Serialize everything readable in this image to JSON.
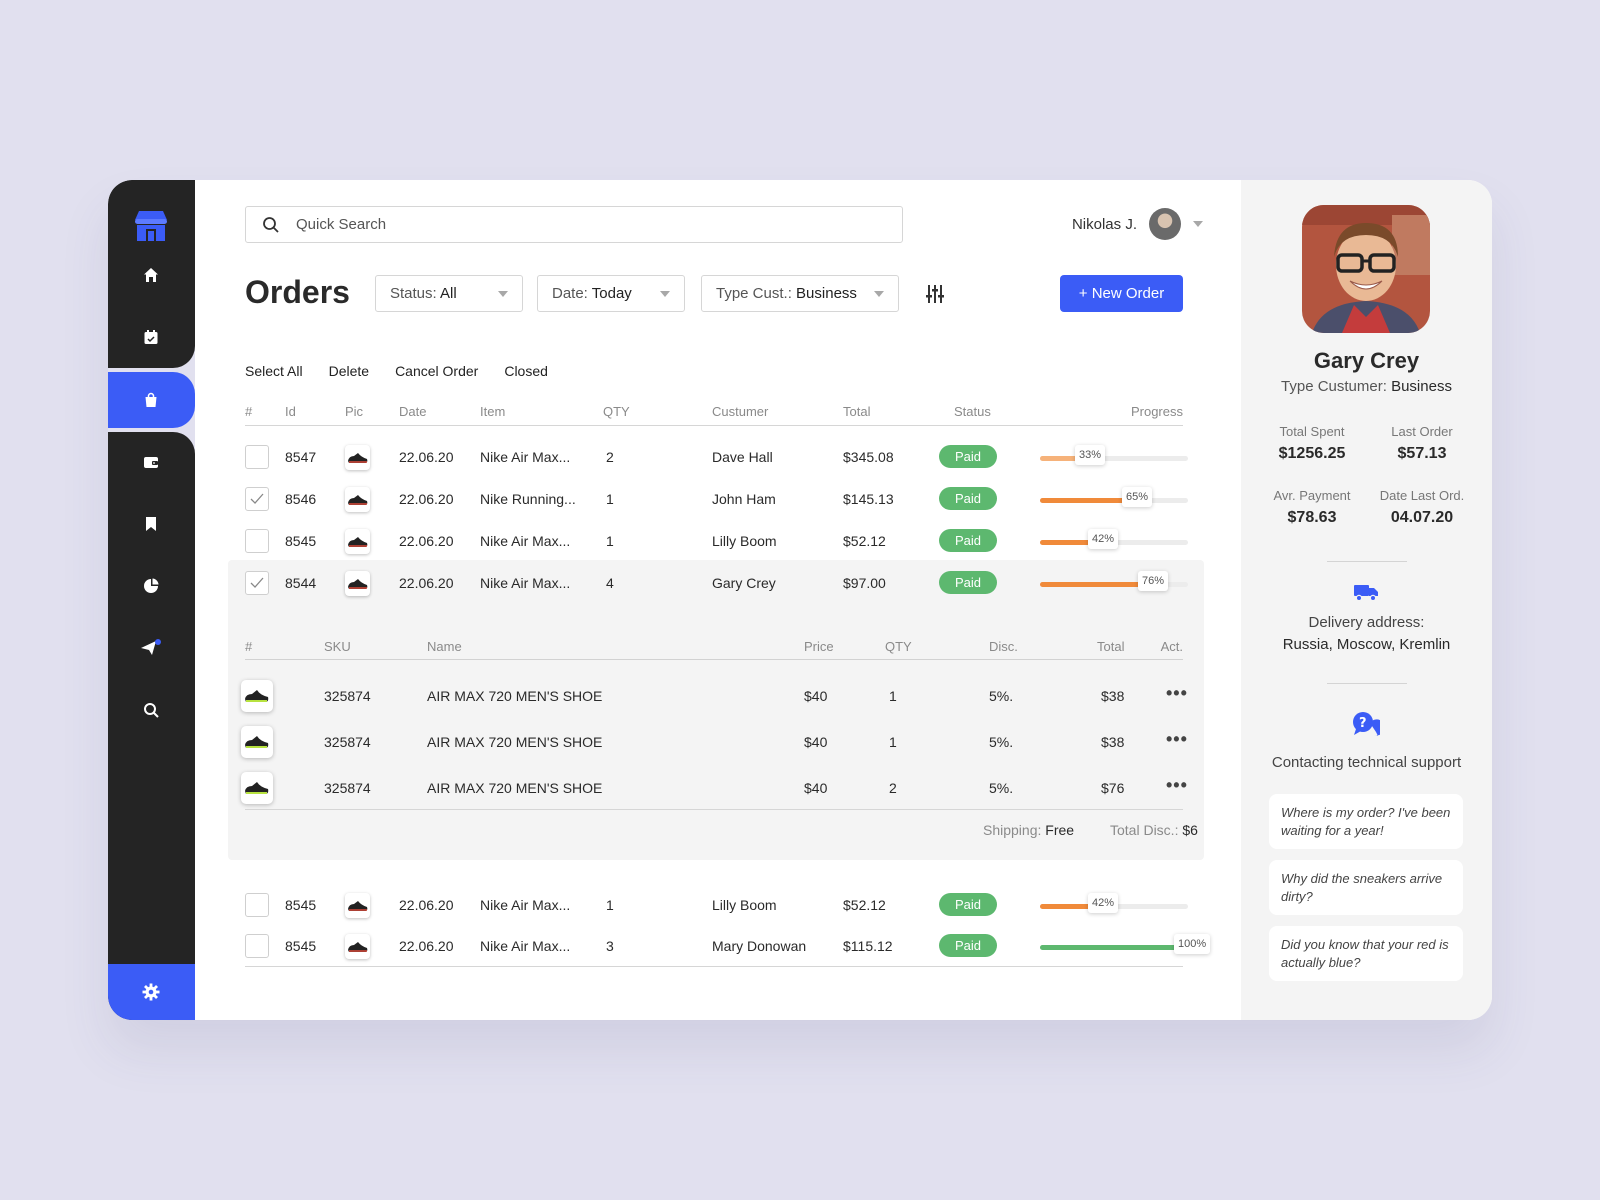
{
  "colors": {
    "accent": "#3b5cf6",
    "sidebar": "#242424",
    "paid": "#5db86f",
    "progress_orange": "#f08a3a",
    "progress_light": "#f6b27a",
    "progress_green": "#5db86f"
  },
  "sidebar": {
    "icons": [
      "shop-logo-icon",
      "home-icon",
      "calendar-icon",
      "shopping-bag-icon",
      "wallet-icon",
      "bookmark-icon",
      "pie-chart-icon",
      "send-icon",
      "search-icon",
      "gear-icon"
    ],
    "active": "shopping-bag-icon"
  },
  "search": {
    "placeholder": "Quick Search"
  },
  "user": {
    "name": "Nikolas J."
  },
  "page": {
    "title": "Orders"
  },
  "filters": [
    {
      "label": "Status:",
      "value": "All"
    },
    {
      "label": "Date:",
      "value": "Today"
    },
    {
      "label": "Type Cust.:",
      "value": "Business"
    }
  ],
  "new_order_label": "+ New Order",
  "actions": [
    "Select All",
    "Delete",
    "Cancel Order",
    "Closed"
  ],
  "table": {
    "headers": [
      "#",
      "Id",
      "Pic",
      "Date",
      "Item",
      "QTY",
      "Custumer",
      "Total",
      "Status",
      "Progress"
    ],
    "rows": [
      {
        "checked": false,
        "id": "8547",
        "date": "22.06.20",
        "item": "Nike Air Max...",
        "qty": "2",
        "customer": "Dave Hall",
        "total": "$345.08",
        "status": "Paid",
        "progress": 33,
        "progress_label": "33%"
      },
      {
        "checked": true,
        "id": "8546",
        "date": "22.06.20",
        "item": "Nike Running...",
        "qty": "1",
        "customer": "John Ham",
        "total": "$145.13",
        "status": "Paid",
        "progress": 65,
        "progress_label": "65%"
      },
      {
        "checked": false,
        "id": "8545",
        "date": "22.06.20",
        "item": "Nike Air Max...",
        "qty": "1",
        "customer": "Lilly Boom",
        "total": "$52.12",
        "status": "Paid",
        "progress": 42,
        "progress_label": "42%"
      },
      {
        "checked": true,
        "id": "8544",
        "date": "22.06.20",
        "item": "Nike Air Max...",
        "qty": "4",
        "customer": "Gary Crey",
        "total": "$97.00",
        "status": "Paid",
        "progress": 76,
        "progress_label": "76%"
      },
      {
        "checked": false,
        "id": "8545",
        "date": "22.06.20",
        "item": "Nike Air Max...",
        "qty": "1",
        "customer": "Lilly Boom",
        "total": "$52.12",
        "status": "Paid",
        "progress": 42,
        "progress_label": "42%"
      },
      {
        "checked": false,
        "id": "8545",
        "date": "22.06.20",
        "item": "Nike Air Max...",
        "qty": "3",
        "customer": "Mary Donowan",
        "total": "$115.12",
        "status": "Paid",
        "progress": 100,
        "progress_label": "100%"
      }
    ]
  },
  "order_detail": {
    "headers": [
      "#",
      "SKU",
      "Name",
      "Price",
      "QTY",
      "Disc.",
      "Total",
      "Act."
    ],
    "items": [
      {
        "sku": "325874",
        "name": "AIR MAX 720 MEN'S SHOE",
        "price": "$40",
        "qty": "1",
        "disc": "5%.",
        "total": "$38"
      },
      {
        "sku": "325874",
        "name": "AIR MAX 720 MEN'S SHOE",
        "price": "$40",
        "qty": "1",
        "disc": "5%.",
        "total": "$38"
      },
      {
        "sku": "325874",
        "name": "AIR MAX 720 MEN'S SHOE",
        "price": "$40",
        "qty": "2",
        "disc": "5%.",
        "total": "$76"
      }
    ],
    "shipping_label": "Shipping:",
    "shipping_value": "Free",
    "total_disc_label": "Total Disc.:",
    "total_disc_value": "$6"
  },
  "customer": {
    "name": "Gary Crey",
    "type_label": "Type Custumer:",
    "type_value": "Business",
    "stats": [
      {
        "label": "Total Spent",
        "value": "$1256.25"
      },
      {
        "label": "Last Order",
        "value": "$57.13"
      },
      {
        "label": "Avr. Payment",
        "value": "$78.63"
      },
      {
        "label": "Date Last Ord.",
        "value": "04.07.20"
      }
    ],
    "delivery_label": "Delivery address:",
    "delivery_value": "Russia, Moscow, Kremlin",
    "support_label": "Contacting technical support",
    "faqs": [
      "Where is my order? I've been waiting for a year!",
      "Why did the sneakers arrive dirty?",
      "Did you know that your red is actually blue?"
    ]
  }
}
